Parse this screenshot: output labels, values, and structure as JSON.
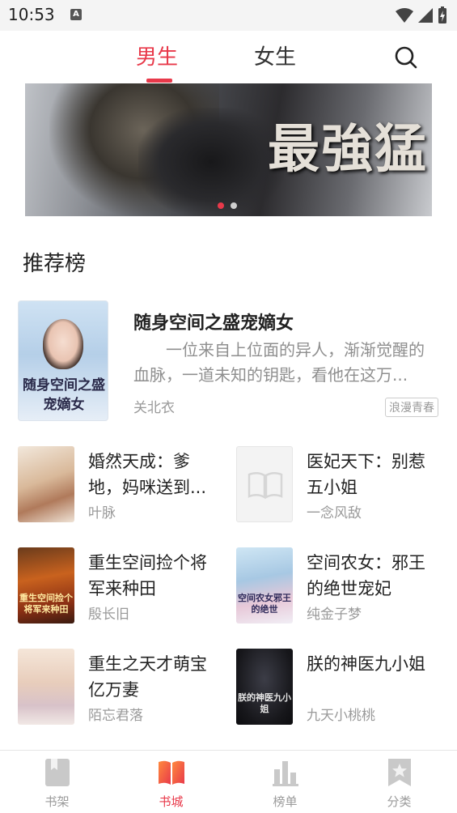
{
  "status_bar": {
    "time": "10:53",
    "notification_letter": "A"
  },
  "tabs": [
    {
      "label": "男生",
      "active": true
    },
    {
      "label": "女生",
      "active": false
    }
  ],
  "accent_color": "#e8394a",
  "banner": {
    "title": "最強猛",
    "slide_count": 2,
    "active_slide": 1
  },
  "section": {
    "title": "推荐榜"
  },
  "featured": {
    "title": "随身空间之盛宠嫡女",
    "description": "一位来自上位面的异人，渐渐觉醒的血脉，一道未知的钥匙，看他在这万...",
    "author": "关北衣",
    "tag": "浪漫青春",
    "cover_text": "随身空间之盛宠嫡女"
  },
  "books": [
    {
      "title": "婚然天成：爹地，妈咪送到...",
      "author": "叶脉"
    },
    {
      "title": "医妃天下：别惹五小姐",
      "author": "一念风敌"
    },
    {
      "title": "重生空间捡个将军来种田",
      "author": "殷长旧",
      "cover_text": "重生空间捡个将军来种田"
    },
    {
      "title": "空间农女：邪王的绝世宠妃",
      "author": "纯金子梦",
      "cover_text": "空间农女邪王的绝世"
    },
    {
      "title": "重生之天才萌宝亿万妻",
      "author": "陌忘君落"
    },
    {
      "title": "朕的神医九小姐",
      "author": "九天小桃桃",
      "cover_text": "朕的神医九小姐"
    }
  ],
  "bottom_nav": [
    {
      "label": "书架",
      "icon": "bookmark-book-icon",
      "active": false
    },
    {
      "label": "书城",
      "icon": "open-book-icon",
      "active": true
    },
    {
      "label": "榜单",
      "icon": "bar-chart-icon",
      "active": false
    },
    {
      "label": "分类",
      "icon": "star-bookmark-icon",
      "active": false
    }
  ]
}
